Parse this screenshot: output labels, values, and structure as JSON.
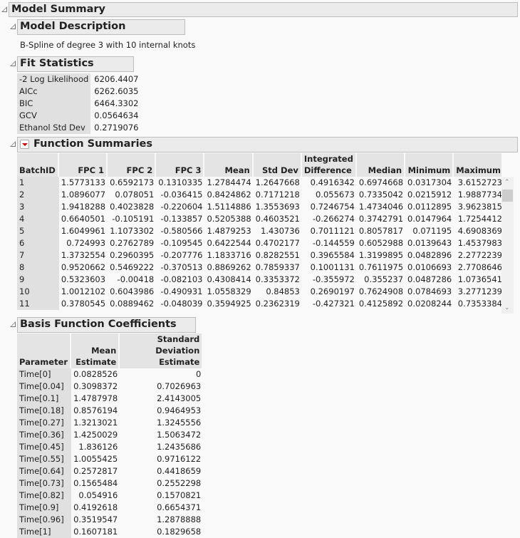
{
  "model_summary": {
    "title": "Model Summary"
  },
  "model_description": {
    "title": "Model Description",
    "text": "B-Spline of degree 3 with 10 internal knots"
  },
  "fit_statistics": {
    "title": "Fit Statistics",
    "rows": [
      [
        "-2 Log Likelihood",
        "6206.4407"
      ],
      [
        "AICc",
        "6262.6035"
      ],
      [
        "BIC",
        "6464.3302"
      ],
      [
        "GCV",
        "0.0564634"
      ],
      [
        "Ethanol Std Dev",
        "0.2719076"
      ]
    ]
  },
  "function_summaries": {
    "title": "Function Summaries",
    "menu_icon": "red-disclosure-menu-icon",
    "menu_color": "#cc0000",
    "columns": [
      "BatchID",
      "FPC 1",
      "FPC 2",
      "FPC 3",
      "Mean",
      "Std Dev",
      "Integrated Difference",
      "Median",
      "Minimum",
      "Maximum"
    ],
    "rows": [
      [
        "1",
        "1.5773133",
        "0.6592173",
        "0.1310335",
        "1.2784474",
        "1.2647668",
        "0.4916342",
        "0.6974668",
        "0.0317304",
        "3.6152723"
      ],
      [
        "2",
        "1.0896077",
        "0.078051",
        "-0.036415",
        "0.8424862",
        "0.7171218",
        "0.055673",
        "0.7335042",
        "0.0215912",
        "1.9887734"
      ],
      [
        "3",
        "1.9418288",
        "0.4023828",
        "-0.220604",
        "1.5114886",
        "1.3553693",
        "0.7246754",
        "1.4734046",
        "0.0112895",
        "3.9623815"
      ],
      [
        "4",
        "0.6640501",
        "-0.105191",
        "-0.133857",
        "0.5205388",
        "0.4603521",
        "-0.266274",
        "0.3742791",
        "0.0147964",
        "1.7254412"
      ],
      [
        "5",
        "1.6049961",
        "1.1073302",
        "-0.580566",
        "1.4879253",
        "1.430736",
        "0.7011121",
        "0.8057817",
        "0.071195",
        "4.6908369"
      ],
      [
        "6",
        "0.724993",
        "0.2762789",
        "-0.109545",
        "0.6422544",
        "0.4702177",
        "-0.144559",
        "0.6052988",
        "0.0139643",
        "1.4537983"
      ],
      [
        "7",
        "1.3732554",
        "0.2960395",
        "-0.207776",
        "1.1833716",
        "0.8282551",
        "0.3965584",
        "1.3199895",
        "0.0482896",
        "2.2772239"
      ],
      [
        "8",
        "0.9520662",
        "0.5469222",
        "-0.370513",
        "0.8869262",
        "0.7859337",
        "0.1001131",
        "0.7611975",
        "0.0106693",
        "2.7708646"
      ],
      [
        "9",
        "0.5323603",
        "-0.00418",
        "-0.082103",
        "0.4308414",
        "0.3353372",
        "-0.355972",
        "0.355237",
        "0.0487286",
        "1.0736541"
      ],
      [
        "10",
        "1.0012102",
        "0.6043986",
        "-0.490931",
        "1.0558329",
        "0.84853",
        "0.2690197",
        "0.7624908",
        "0.0784693",
        "3.2771239"
      ],
      [
        "11",
        "0.3780545",
        "0.0889462",
        "-0.048039",
        "0.3594925",
        "0.2362319",
        "-0.427321",
        "0.4125892",
        "0.0208244",
        "0.7353384"
      ]
    ]
  },
  "basis_coefficients": {
    "title": "Basis Function Coefficients",
    "columns": [
      "Parameter",
      "Mean Estimate",
      "Standard Deviation Estimate"
    ],
    "rows": [
      [
        "Time[0]",
        "0.0828526",
        "0"
      ],
      [
        "Time[0.04]",
        "0.3098372",
        "0.7026963"
      ],
      [
        "Time[0.1]",
        "1.4787978",
        "2.4143005"
      ],
      [
        "Time[0.18]",
        "0.8576194",
        "0.9464953"
      ],
      [
        "Time[0.27]",
        "1.3213021",
        "1.3245556"
      ],
      [
        "Time[0.36]",
        "1.4250029",
        "1.5063472"
      ],
      [
        "Time[0.45]",
        "1.836126",
        "1.2435686"
      ],
      [
        "Time[0.55]",
        "1.0055425",
        "0.9716122"
      ],
      [
        "Time[0.64]",
        "0.2572817",
        "0.4418659"
      ],
      [
        "Time[0.73]",
        "0.1565484",
        "0.2552298"
      ],
      [
        "Time[0.82]",
        "0.054916",
        "0.1570821"
      ],
      [
        "Time[0.9]",
        "0.4192618",
        "0.6654371"
      ],
      [
        "Time[0.96]",
        "0.3519547",
        "1.2878888"
      ],
      [
        "Time[1]",
        "0.1607181",
        "0.1829658"
      ]
    ]
  }
}
